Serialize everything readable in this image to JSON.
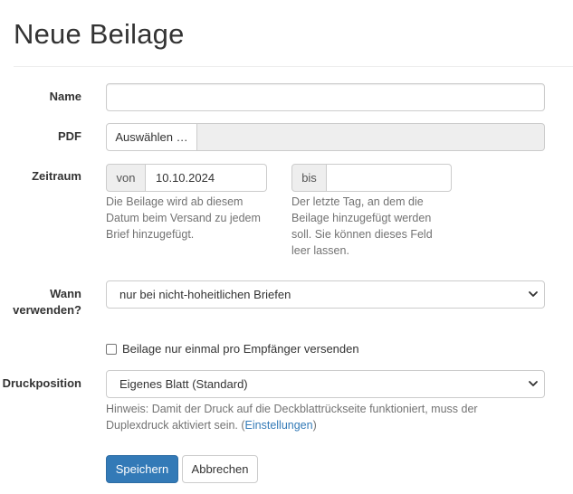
{
  "page": {
    "title": "Neue Beilage"
  },
  "form": {
    "name": {
      "label": "Name",
      "value": ""
    },
    "pdf": {
      "label": "PDF",
      "button_label": "Auswählen …"
    },
    "zeitraum": {
      "label": "Zeitraum",
      "from_addon": "von",
      "from_value": "10.10.2024",
      "from_help": [
        "Die Beilage wird ab diesem",
        "Datum beim Versand zu jedem",
        "Brief hinzugefügt."
      ],
      "to_addon": "bis",
      "to_value": "",
      "to_help": [
        "Der letzte Tag, an dem die",
        "Beilage hinzugefügt werden",
        "soll. Sie können dieses Feld",
        "leer lassen."
      ]
    },
    "wann": {
      "label_line1": "Wann",
      "label_line2": "verwenden?",
      "selected": "nur bei nicht-hoheitlichen Briefen"
    },
    "once_checkbox": {
      "label": "Beilage nur einmal pro Empfänger versenden",
      "checked": false
    },
    "druckposition": {
      "label": "Druckposition",
      "selected": "Eigenes Blatt (Standard)",
      "hint_line1": "Hinweis: Damit der Druck auf die Deckblattrückseite funktioniert, muss der",
      "hint_line2_prefix": "Duplexdruck aktiviert sein. (",
      "hint_link": "Einstellungen",
      "hint_line2_suffix": ")"
    },
    "save_label": "Speichern",
    "cancel_label": "Abbrechen"
  },
  "colors": {
    "primary": "#337ab7",
    "link": "#337ab7",
    "addon_bg": "#eeeeee",
    "help_text": "#737373"
  }
}
